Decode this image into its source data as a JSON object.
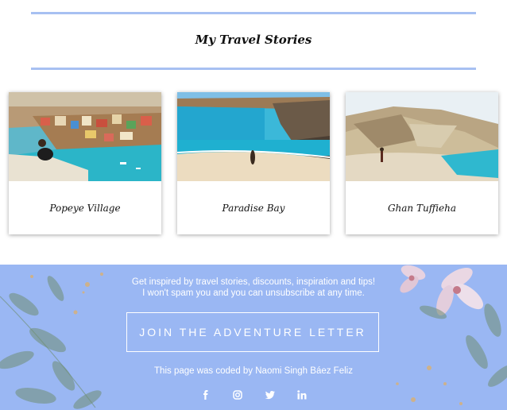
{
  "section": {
    "title": "My Travel Stories"
  },
  "stories": [
    {
      "caption": "Popeye Village"
    },
    {
      "caption": "Paradise Bay"
    },
    {
      "caption": "Ghan Tuffieha"
    }
  ],
  "footer": {
    "tagline_line1": "Get inspired by travel stories, discounts, inspiration and tips!",
    "tagline_line2": "I won't spam you and you can unsubscribe at any time.",
    "cta_label": "JOIN THE ADVENTURE LETTER",
    "credit": "This page was coded by Naomi Singh Báez Feliz",
    "social_icons": [
      "facebook-icon",
      "instagram-icon",
      "twitter-icon",
      "linkedin-icon"
    ]
  },
  "colors": {
    "rule": "#a7c0f2",
    "footer_bg": "#9ab7f3",
    "footer_text": "#ffffff"
  }
}
